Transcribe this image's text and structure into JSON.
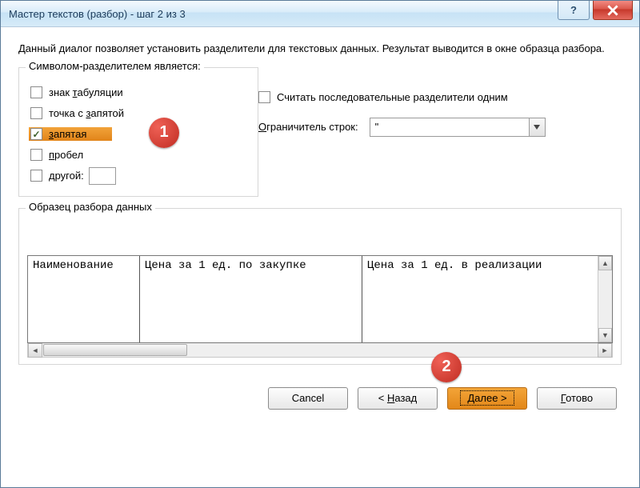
{
  "title": "Мастер текстов (разбор) - шаг 2 из 3",
  "description": "Данный диалог позволяет установить разделители для текстовых данных. Результат выводится в окне образца разбора.",
  "delim_group_title": "Символом-разделителем является:",
  "delimiters": {
    "tab": {
      "label": "знак табуляции",
      "accel": "т",
      "checked": false
    },
    "semicolon": {
      "label": "точка с запятой",
      "accel": "з",
      "checked": false
    },
    "comma": {
      "label": "запятая",
      "accel": "з",
      "checked": true
    },
    "space": {
      "label": "пробел",
      "accel": "п",
      "checked": false
    },
    "other": {
      "label": "другой:",
      "accel": "д",
      "checked": false
    }
  },
  "treat_consecutive": {
    "label": "Считать последовательные разделители одним",
    "checked": false
  },
  "qualifier_label": "Ограничитель строк:",
  "qualifier_value": "\"",
  "preview_title": "Образец разбора данных",
  "preview_columns": [
    "Наименование",
    "Цена за 1 ед. по закупке",
    "Цена за 1 ед. в реализации"
  ],
  "buttons": {
    "cancel": "Cancel",
    "back": "< Назад",
    "next": "Далее >",
    "finish": "Готово"
  },
  "markers": {
    "m1": "1",
    "m2": "2"
  }
}
